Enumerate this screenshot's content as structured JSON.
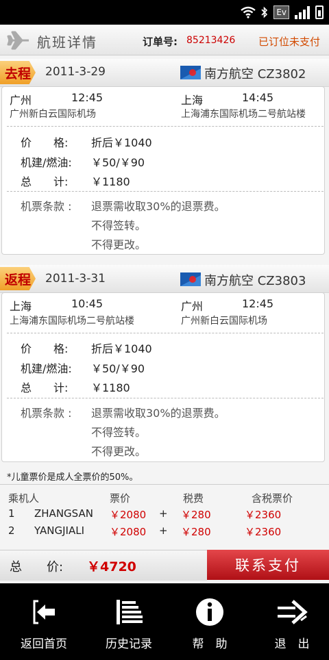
{
  "status_bar": {
    "ev": "Ev"
  },
  "header": {
    "title": "航班详情",
    "order_label": "订单号:",
    "order_no": "85213426",
    "status": "已订位未支付"
  },
  "trips": [
    {
      "tag": "去程",
      "date": "2011-3-29",
      "airline": "南方航空",
      "flight": "CZ3802",
      "from_city": "广州",
      "dep_time": "12:45",
      "to_city": "上海",
      "arr_time": "14:45",
      "from_airport": "广州新白云国际机场",
      "to_airport": "上海浦东国际机场二号航站楼",
      "price_label": "价　　格:",
      "price": "折后￥1040",
      "tax_label": "机建/燃油:",
      "tax": "￥50/￥90",
      "total_label": "总　　计:",
      "total": "￥1180",
      "terms_label": "机票条款 :",
      "terms": [
        "退票需收取30%的退票费。",
        "不得签转。",
        "不得更改。"
      ]
    },
    {
      "tag": "返程",
      "date": "2011-3-31",
      "airline": "南方航空",
      "flight": "CZ3803",
      "from_city": "上海",
      "dep_time": "10:45",
      "to_city": "广州",
      "arr_time": "12:45",
      "from_airport": "上海浦东国际机场二号航站楼",
      "to_airport": "广州新白云国际机场",
      "price_label": "价　　格:",
      "price": "折后￥1040",
      "tax_label": "机建/燃油:",
      "tax": "￥50/￥90",
      "total_label": "总　　计:",
      "total": "￥1180",
      "terms_label": "机票条款 :",
      "terms": [
        "退票需收取30%的退票费。",
        "不得签转。",
        "不得更改。"
      ]
    }
  ],
  "note": "*儿童票价是成人全票价的50%。",
  "passengers": {
    "headers": [
      "乘机人",
      "票价",
      "税费",
      "含税票价"
    ],
    "rows": [
      {
        "idx": "1",
        "name": "ZHANGSAN",
        "price": "￥2080",
        "plus": "+",
        "tax": "￥280",
        "total": "￥2360"
      },
      {
        "idx": "2",
        "name": "YANGJIALI",
        "price": "￥2080",
        "plus": "+",
        "tax": "￥280",
        "total": "￥2360"
      }
    ]
  },
  "total": {
    "label": "总　　价:",
    "value": "￥4720"
  },
  "pay_button": "联系支付",
  "nav": [
    {
      "label": "返回首页",
      "icon": "back-home-icon"
    },
    {
      "label": "历史记录",
      "icon": "history-list-icon"
    },
    {
      "label": "帮　助",
      "icon": "info-icon"
    },
    {
      "label": "退　出",
      "icon": "exit-arrow-icon"
    }
  ]
}
